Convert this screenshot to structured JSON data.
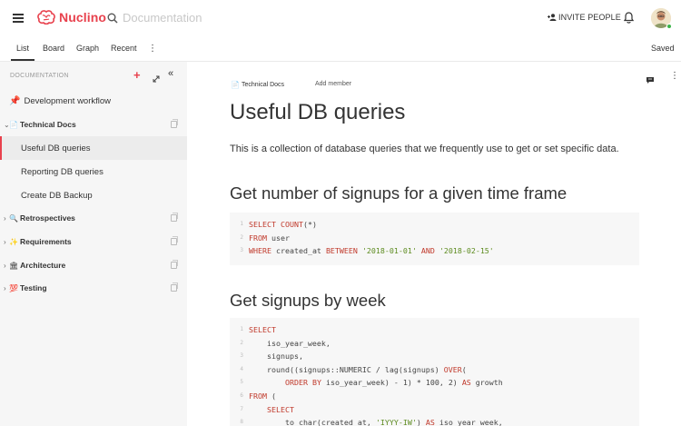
{
  "app": {
    "name": "Nuclino",
    "brand_color": "#e8414d",
    "search_placeholder": "Documentation",
    "invite_label": "INVITE PEOPLE"
  },
  "tabs": [
    {
      "label": "List",
      "active": true
    },
    {
      "label": "Board",
      "active": false
    },
    {
      "label": "Graph",
      "active": false
    },
    {
      "label": "Recent",
      "active": false
    }
  ],
  "status": "Saved",
  "sidebar": {
    "header": "DOCUMENTATION",
    "add_symbol": "+",
    "collapse_symbol": "«",
    "items": [
      {
        "label": "Development workflow",
        "icon": "pin",
        "emoji": "📌"
      },
      {
        "label": "Technical Docs",
        "icon": "page",
        "emoji": "📄"
      },
      {
        "label": "Useful DB queries",
        "active": true
      },
      {
        "label": "Reporting DB queries"
      },
      {
        "label": "Create DB Backup"
      },
      {
        "label": "Retrospectives",
        "icon": "magnifier",
        "emoji": "🔍"
      },
      {
        "label": "Requirements",
        "icon": "sparkles",
        "emoji": "✨"
      },
      {
        "label": "Architecture",
        "icon": "classical-building",
        "emoji": "🏛"
      },
      {
        "label": "Testing",
        "icon": "hundred-points",
        "emoji": "💯"
      }
    ]
  },
  "document": {
    "breadcrumb": "Technical Docs",
    "breadcrumb_emoji": "📄",
    "add_member": "Add member",
    "title": "Useful DB queries",
    "intro": "This is a collection of database queries that we frequently use to get or set specific data.",
    "section1": {
      "heading": "Get number of signups for a given time frame",
      "code": [
        {
          "n": "1",
          "text": "SELECT COUNT(*)"
        },
        {
          "n": "2",
          "text": "FROM user"
        },
        {
          "n": "3",
          "text": "WHERE created_at BETWEEN '2018-01-01' AND '2018-02-15'"
        }
      ]
    },
    "section2": {
      "heading": "Get signups by week",
      "code": [
        {
          "n": "1",
          "text": "SELECT"
        },
        {
          "n": "2",
          "text": "    iso_year_week,"
        },
        {
          "n": "3",
          "text": "    signups,"
        },
        {
          "n": "4",
          "text": "    round((signups::NUMERIC / lag(signups) OVER("
        },
        {
          "n": "5",
          "text": "        ORDER BY iso_year_week) - 1) * 100, 2) AS growth"
        },
        {
          "n": "6",
          "text": "FROM ("
        },
        {
          "n": "7",
          "text": "    SELECT"
        },
        {
          "n": "8",
          "text": "        to_char(created_at, 'IYYY-IW') AS iso_year_week,"
        }
      ]
    }
  }
}
